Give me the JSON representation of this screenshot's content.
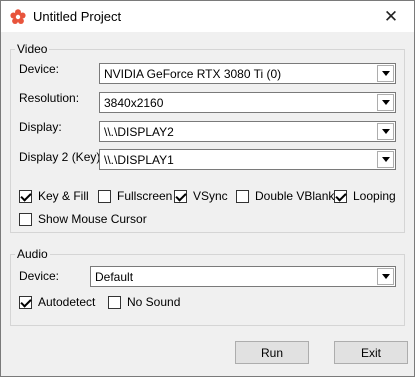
{
  "window": {
    "title": "Untitled Project",
    "close_glyph": "✕",
    "app_icon": "gear-flower-icon",
    "accent": "#e8543c"
  },
  "video": {
    "legend": "Video",
    "device_label": "Device:",
    "device_value": "NVIDIA GeForce RTX 3080 Ti (0)",
    "resolution_label": "Resolution:",
    "resolution_value": "3840x2160",
    "display_label": "Display:",
    "display_value": "\\\\.\\DISPLAY2",
    "display2_label": "Display 2 (Key):",
    "display2_value": "\\\\.\\DISPLAY1",
    "options": [
      {
        "label": "Key & Fill",
        "checked": true
      },
      {
        "label": "Fullscreen",
        "checked": false
      },
      {
        "label": "VSync",
        "checked": true
      },
      {
        "label": "Double VBlank",
        "checked": false
      },
      {
        "label": "Looping",
        "checked": true
      },
      {
        "label": "Show Mouse Cursor",
        "checked": false
      }
    ]
  },
  "audio": {
    "legend": "Audio",
    "device_label": "Device:",
    "device_value": "Default",
    "options": [
      {
        "label": "Autodetect",
        "checked": true
      },
      {
        "label": "No Sound",
        "checked": false
      }
    ]
  },
  "buttons": {
    "run": "Run",
    "exit": "Exit"
  }
}
